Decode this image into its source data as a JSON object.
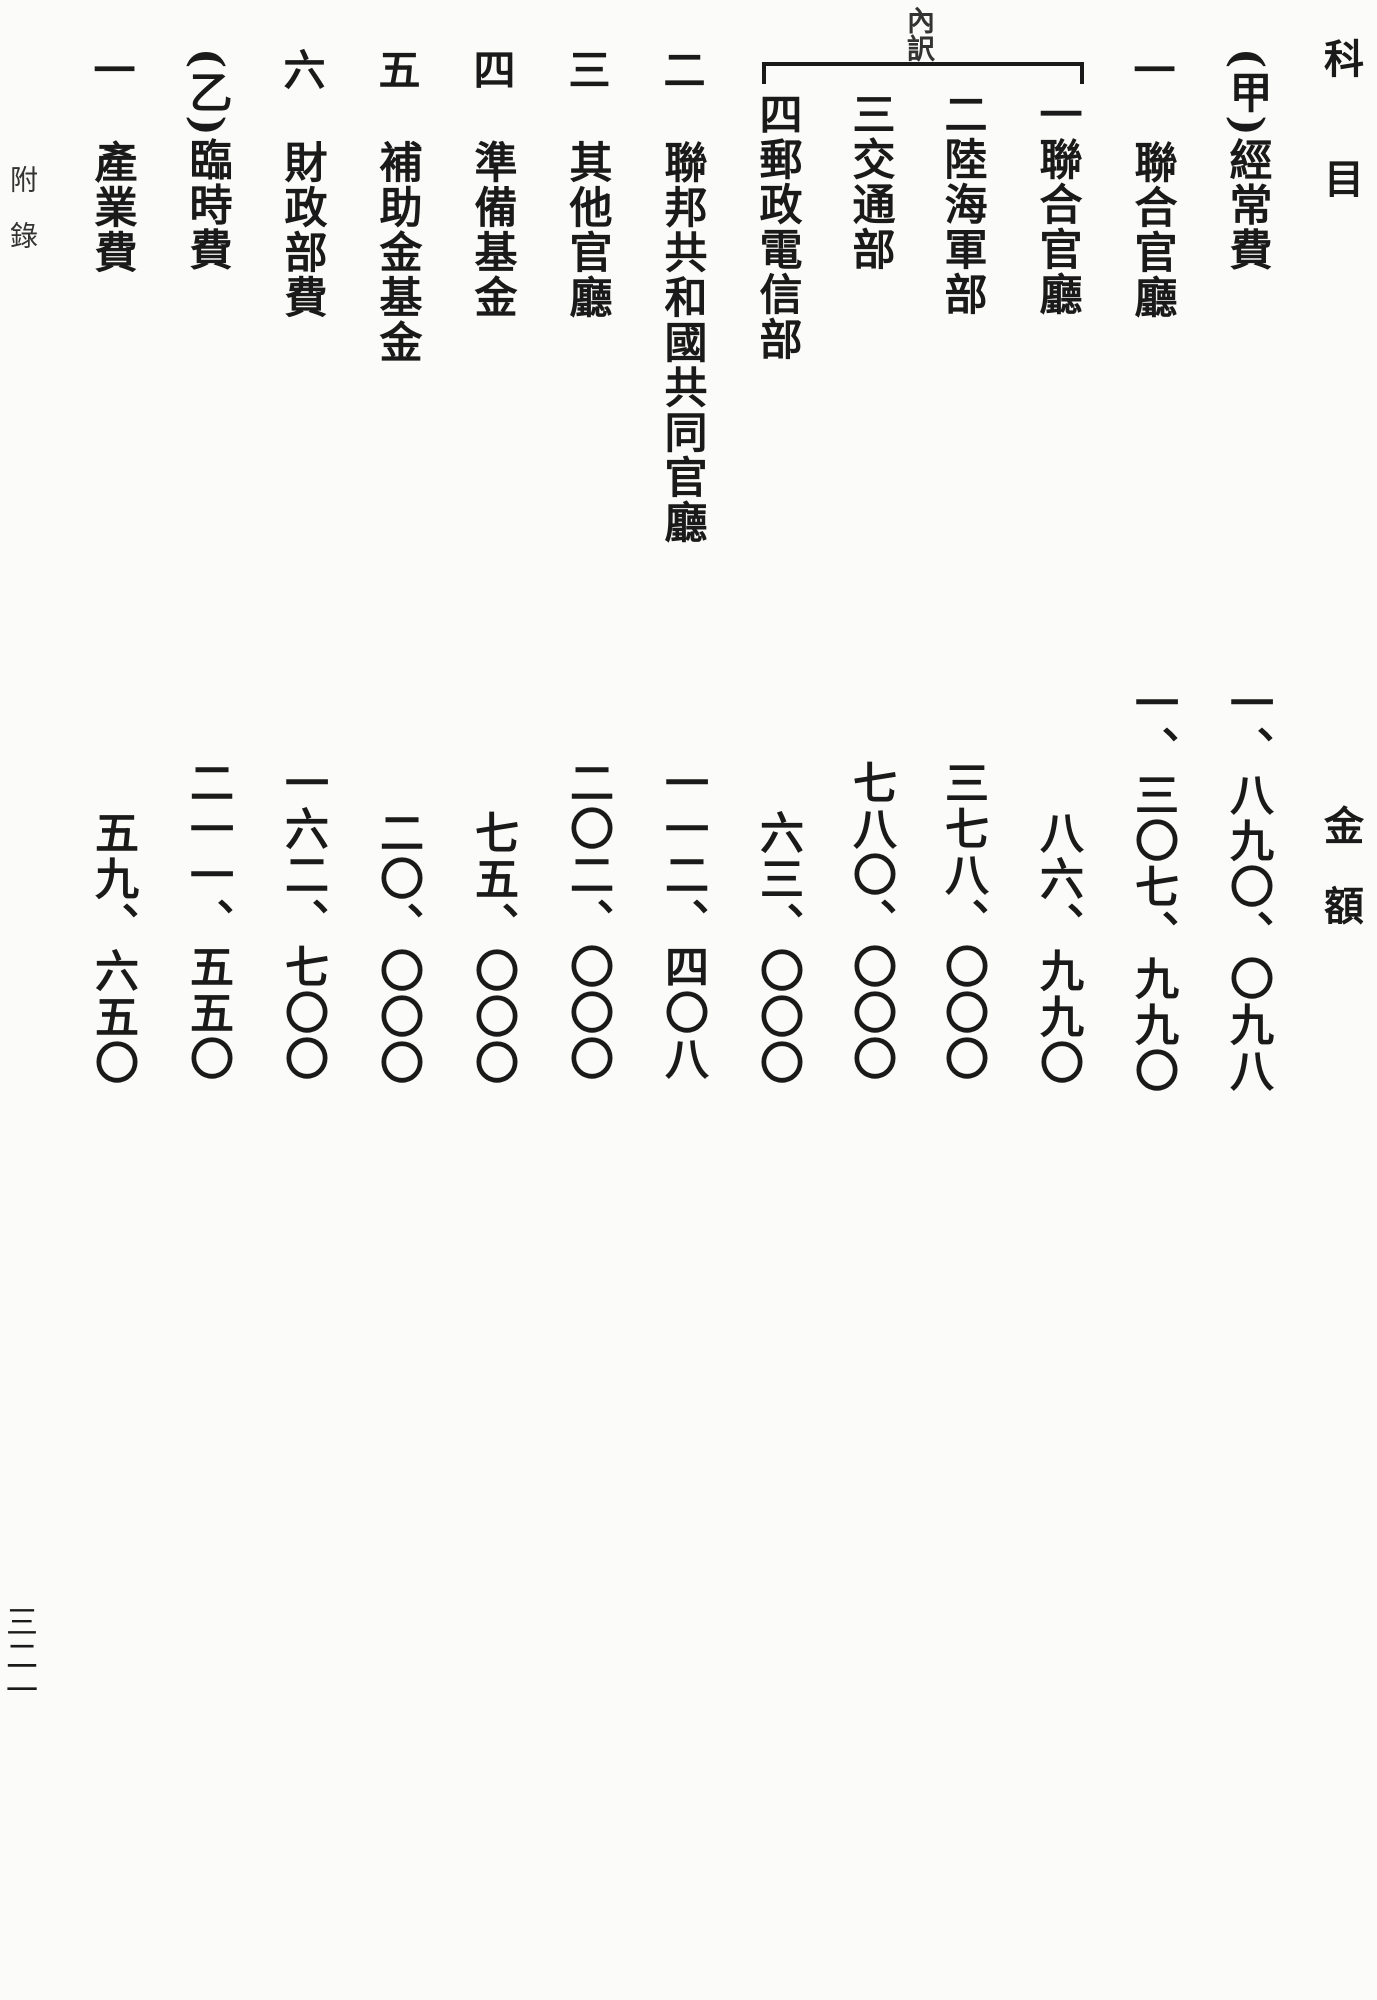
{
  "header": {
    "kamoku": "科　　目",
    "kingaku": "金　額"
  },
  "rows": [
    {
      "mark": "",
      "label": "(甲)經常費",
      "amount": "一、八九〇、〇九八"
    },
    {
      "mark": "一",
      "label": "聯合官廳",
      "amount": "一、三〇七、九九〇"
    },
    {
      "mark": "",
      "label": "一聯合官廳",
      "amount": "八六、九九〇"
    },
    {
      "mark": "",
      "label": "二陸海軍部",
      "amount": "三七八、〇〇〇"
    },
    {
      "mark": "",
      "label": "三交通部",
      "amount": "七八〇、〇〇〇"
    },
    {
      "mark": "",
      "label": "四郵政電信部",
      "amount": "六三、〇〇〇"
    },
    {
      "mark": "二",
      "label": "聯邦共和國共同官廳",
      "amount": "一一二、四〇八"
    },
    {
      "mark": "三",
      "label": "其他官廳",
      "amount": "二〇二、〇〇〇"
    },
    {
      "mark": "四",
      "label": "準備基金",
      "amount": "七五、〇〇〇"
    },
    {
      "mark": "五",
      "label": "補助金基金",
      "amount": "二〇、〇〇〇"
    },
    {
      "mark": "六",
      "label": "財政部費",
      "amount": "一六二、七〇〇"
    },
    {
      "mark": "",
      "label": "(乙)臨時費",
      "amount": "二一一、五五〇"
    },
    {
      "mark": "一",
      "label": "產業費",
      "amount": "五九、六五〇"
    }
  ],
  "bracket_label": "內訳",
  "margin": {
    "section": "附　錄",
    "page_number": "三二一"
  }
}
